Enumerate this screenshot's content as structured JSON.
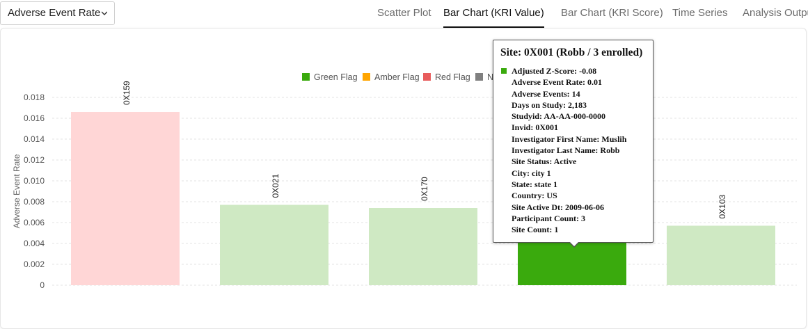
{
  "metric_select": {
    "value": "Adverse Event Rate"
  },
  "tabs": [
    {
      "label": "Scatter Plot",
      "active": false
    },
    {
      "label": "Bar Chart (KRI Value)",
      "active": true
    },
    {
      "label": "Bar Chart (KRI Score)",
      "active": false
    },
    {
      "label": "Time Series",
      "active": false
    },
    {
      "label": "Analysis Output",
      "active": false
    }
  ],
  "colors": {
    "green": "#3aaa0d",
    "green_light": "#cfe9c3",
    "amber": "#ffa500",
    "red": "#e85c5c",
    "red_light": "#ffd6d6",
    "none": "#808080"
  },
  "chart_data": {
    "type": "bar",
    "ylabel": "Adverse Event Rate",
    "xlabel": "",
    "title": "",
    "ylim": [
      0,
      0.018
    ],
    "yticks": [
      "0",
      "0.002",
      "0.004",
      "0.006",
      "0.008",
      "0.010",
      "0.012",
      "0.014",
      "0.016",
      "0.018"
    ],
    "grid": true,
    "legend_position": "top-center",
    "legend": [
      {
        "label": "Green Flag",
        "color": "#3aaa0d"
      },
      {
        "label": "Amber Flag",
        "color": "#ffa500"
      },
      {
        "label": "Red Flag",
        "color": "#e85c5c"
      },
      {
        "label": "No Flag",
        "color": "#808080"
      }
    ],
    "categories": [
      "0X159",
      "0X021",
      "0X170",
      "0X001",
      "0X103"
    ],
    "values": [
      0.0166,
      0.0077,
      0.0074,
      0.0064,
      0.0057
    ],
    "flags": [
      "red",
      "green",
      "green",
      "green",
      "green"
    ],
    "highlighted": "0X001"
  },
  "tooltip": {
    "title": "Site: 0X001 (Robb / 3 enrolled)",
    "lines": [
      "Adjusted Z-Score: -0.08",
      "Adverse Event Rate: 0.01",
      "Adverse Events: 14",
      "Days on Study: 2,183",
      "Studyid: AA-AA-000-0000",
      "Invid: 0X001",
      "Investigator First Name: Muslih",
      "Investigator Last Name: Robb",
      "Site Status: Active",
      "City: city 1",
      "State: state 1",
      "Country: US",
      "Site Active Dt: 2009-06-06",
      "Participant Count: 3",
      "Site Count: 1"
    ]
  }
}
